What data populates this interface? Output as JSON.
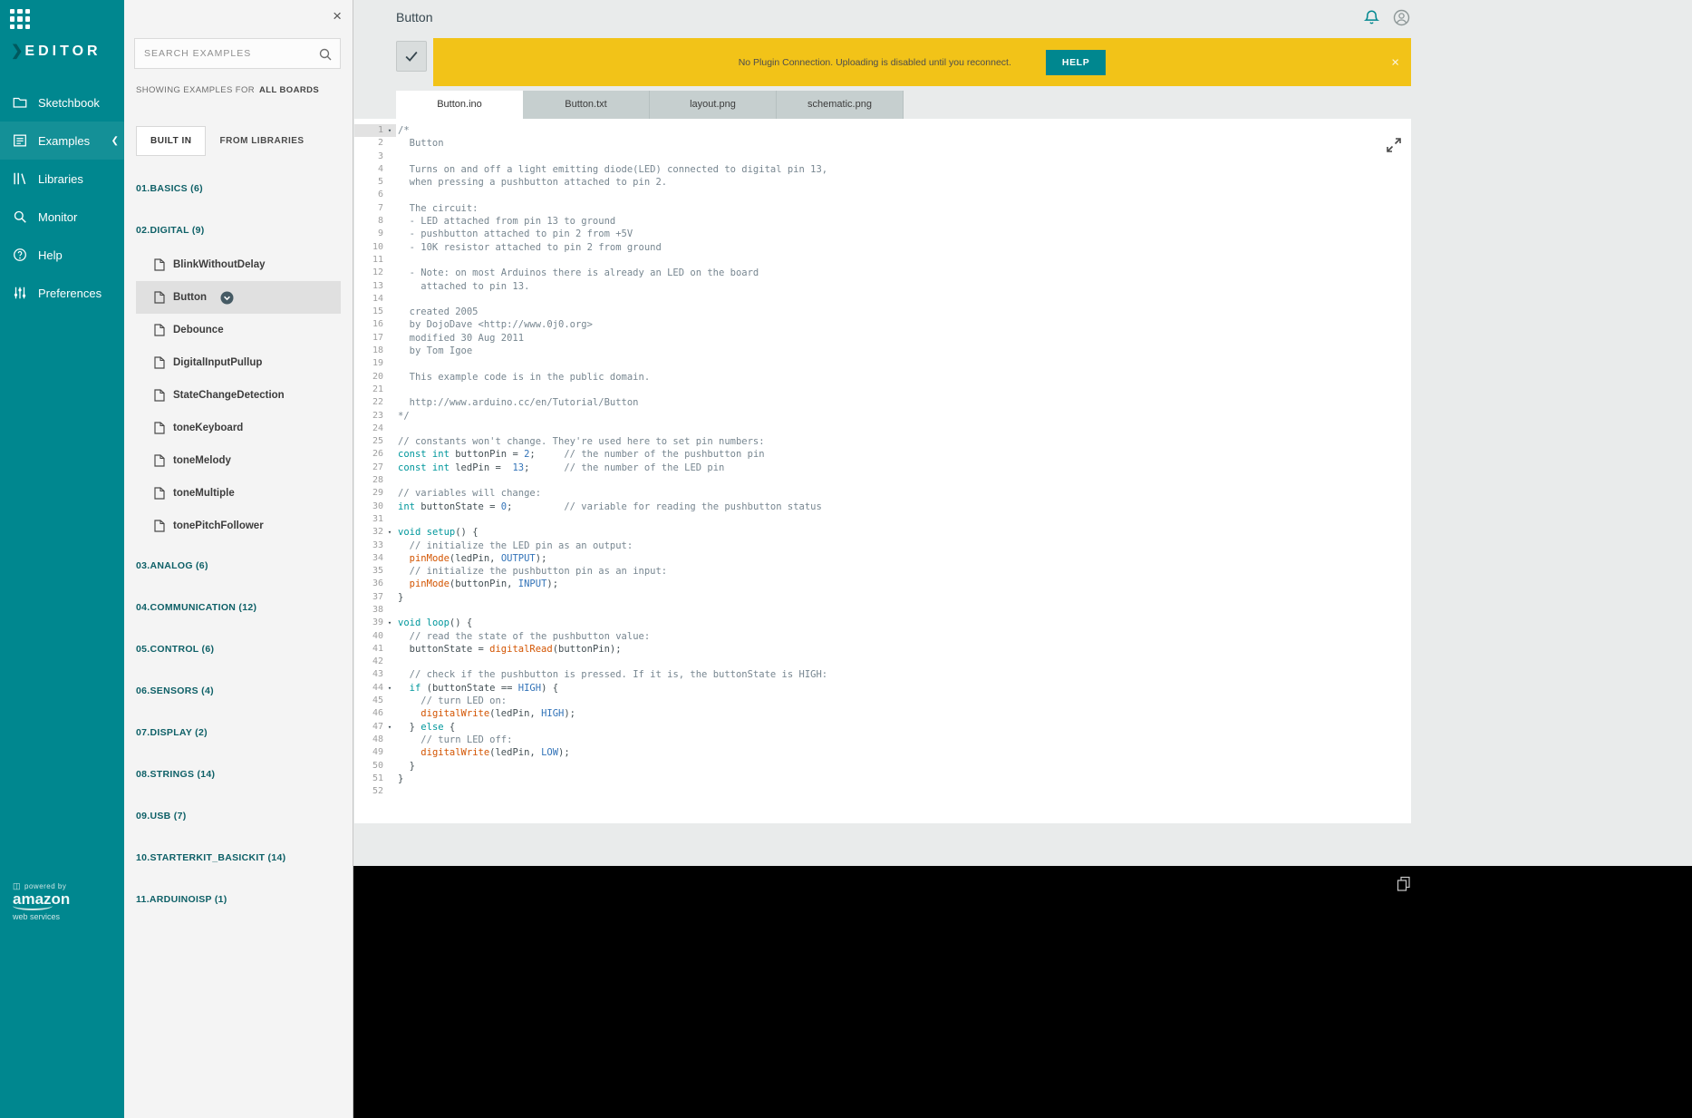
{
  "app": {
    "logo_text": "EDITOR"
  },
  "colors": {
    "teal": "#00878f",
    "banner_yellow": "#f2c318"
  },
  "sidebar": {
    "items": [
      {
        "label": "Sketchbook",
        "icon": "sketchbook",
        "active": false
      },
      {
        "label": "Examples",
        "icon": "examples",
        "active": true
      },
      {
        "label": "Libraries",
        "icon": "libraries",
        "active": false
      },
      {
        "label": "Monitor",
        "icon": "monitor",
        "active": false
      },
      {
        "label": "Help",
        "icon": "help",
        "active": false
      },
      {
        "label": "Preferences",
        "icon": "preferences",
        "active": false
      }
    ],
    "footer": {
      "powered_by": "powered by",
      "brand": "amazon",
      "brand_sub": "web services"
    }
  },
  "examples_panel": {
    "close_label": "×",
    "search_placeholder": "SEARCH EXAMPLES",
    "showing_prefix": "SHOWING EXAMPLES FOR",
    "showing_value": "ALL BOARDS",
    "tabs": [
      {
        "label": "BUILT IN",
        "active": true
      },
      {
        "label": "FROM LIBRARIES",
        "active": false
      }
    ],
    "categories": [
      {
        "label": "01.BASICS (6)"
      },
      {
        "label": "02.DIGITAL (9)",
        "items": [
          {
            "label": "BlinkWithoutDelay"
          },
          {
            "label": "Button",
            "selected": true,
            "badge": true
          },
          {
            "label": "Debounce"
          },
          {
            "label": "DigitalInputPullup"
          },
          {
            "label": "StateChangeDetection"
          },
          {
            "label": "toneKeyboard"
          },
          {
            "label": "toneMelody"
          },
          {
            "label": "toneMultiple"
          },
          {
            "label": "tonePitchFollower"
          }
        ]
      },
      {
        "label": "03.ANALOG (6)"
      },
      {
        "label": "04.COMMUNICATION (12)"
      },
      {
        "label": "05.CONTROL (6)"
      },
      {
        "label": "06.SENSORS (4)"
      },
      {
        "label": "07.DISPLAY (2)"
      },
      {
        "label": "08.STRINGS (14)"
      },
      {
        "label": "09.USB (7)"
      },
      {
        "label": "10.STARTERKIT_BASICKIT (14)"
      },
      {
        "label": "11.ARDUINOISP (1)"
      }
    ]
  },
  "header": {
    "title": "Button"
  },
  "banner": {
    "message": "No Plugin Connection. Uploading is disabled until you reconnect.",
    "help_label": "HELP",
    "close_label": "×"
  },
  "file_tabs": [
    {
      "label": "Button.ino",
      "active": true
    },
    {
      "label": "Button.txt",
      "active": false
    },
    {
      "label": "layout.png",
      "active": false
    },
    {
      "label": "schematic.png",
      "active": false
    }
  ],
  "editor": {
    "lines": [
      {
        "f": 1,
        "s": [
          [
            "c",
            "/*"
          ]
        ]
      },
      {
        "s": [
          [
            "c",
            "  Button"
          ]
        ]
      },
      {
        "s": []
      },
      {
        "s": [
          [
            "c",
            "  Turns on and off a light emitting diode(LED) connected to digital pin 13,"
          ]
        ]
      },
      {
        "s": [
          [
            "c",
            "  when pressing a pushbutton attached to pin 2."
          ]
        ]
      },
      {
        "s": []
      },
      {
        "s": [
          [
            "c",
            "  The circuit:"
          ]
        ]
      },
      {
        "s": [
          [
            "c",
            "  - LED attached from pin 13 to ground"
          ]
        ]
      },
      {
        "s": [
          [
            "c",
            "  - pushbutton attached to pin 2 from +5V"
          ]
        ]
      },
      {
        "s": [
          [
            "c",
            "  - 10K resistor attached to pin 2 from ground"
          ]
        ]
      },
      {
        "s": []
      },
      {
        "s": [
          [
            "c",
            "  - Note: on most Arduinos there is already an LED on the board"
          ]
        ]
      },
      {
        "s": [
          [
            "c",
            "    attached to pin 13."
          ]
        ]
      },
      {
        "s": []
      },
      {
        "s": [
          [
            "c",
            "  created 2005"
          ]
        ]
      },
      {
        "s": [
          [
            "c",
            "  by DojoDave <http://www.0j0.org>"
          ]
        ]
      },
      {
        "s": [
          [
            "c",
            "  modified 30 Aug 2011"
          ]
        ]
      },
      {
        "s": [
          [
            "c",
            "  by Tom Igoe"
          ]
        ]
      },
      {
        "s": []
      },
      {
        "s": [
          [
            "c",
            "  This example code is in the public domain."
          ]
        ]
      },
      {
        "s": []
      },
      {
        "s": [
          [
            "c",
            "  http://www.arduino.cc/en/Tutorial/Button"
          ]
        ]
      },
      {
        "s": [
          [
            "c",
            "*/"
          ]
        ]
      },
      {
        "s": []
      },
      {
        "s": [
          [
            "c",
            "// constants won't change. They're used here to set pin numbers:"
          ]
        ]
      },
      {
        "s": [
          [
            "k",
            "const int"
          ],
          [
            "t",
            " buttonPin = "
          ],
          [
            "n",
            "2"
          ],
          [
            "t",
            ";     "
          ],
          [
            "c",
            "// the number of the pushbutton pin"
          ]
        ]
      },
      {
        "s": [
          [
            "k",
            "const int"
          ],
          [
            "t",
            " ledPin =  "
          ],
          [
            "n",
            "13"
          ],
          [
            "t",
            ";      "
          ],
          [
            "c",
            "// the number of the LED pin"
          ]
        ]
      },
      {
        "s": []
      },
      {
        "s": [
          [
            "c",
            "// variables will change:"
          ]
        ]
      },
      {
        "s": [
          [
            "k",
            "int"
          ],
          [
            "t",
            " buttonState = "
          ],
          [
            "n",
            "0"
          ],
          [
            "t",
            ";         "
          ],
          [
            "c",
            "// variable for reading the pushbutton status"
          ]
        ]
      },
      {
        "s": []
      },
      {
        "f": 1,
        "s": [
          [
            "k",
            "void"
          ],
          [
            "t",
            " "
          ],
          [
            "k",
            "setup"
          ],
          [
            "t",
            "() {"
          ]
        ]
      },
      {
        "s": [
          [
            "t",
            "  "
          ],
          [
            "c",
            "// initialize the LED pin as an output:"
          ]
        ]
      },
      {
        "s": [
          [
            "t",
            "  "
          ],
          [
            "f",
            "pinMode"
          ],
          [
            "t",
            "(ledPin, "
          ],
          [
            "n",
            "OUTPUT"
          ],
          [
            "t",
            ");"
          ]
        ]
      },
      {
        "s": [
          [
            "t",
            "  "
          ],
          [
            "c",
            "// initialize the pushbutton pin as an input:"
          ]
        ]
      },
      {
        "s": [
          [
            "t",
            "  "
          ],
          [
            "f",
            "pinMode"
          ],
          [
            "t",
            "(buttonPin, "
          ],
          [
            "n",
            "INPUT"
          ],
          [
            "t",
            ");"
          ]
        ]
      },
      {
        "s": [
          [
            "t",
            "}"
          ]
        ]
      },
      {
        "s": []
      },
      {
        "f": 1,
        "s": [
          [
            "k",
            "void"
          ],
          [
            "t",
            " "
          ],
          [
            "k",
            "loop"
          ],
          [
            "t",
            "() {"
          ]
        ]
      },
      {
        "s": [
          [
            "t",
            "  "
          ],
          [
            "c",
            "// read the state of the pushbutton value:"
          ]
        ]
      },
      {
        "s": [
          [
            "t",
            "  buttonState = "
          ],
          [
            "f",
            "digitalRead"
          ],
          [
            "t",
            "(buttonPin);"
          ]
        ]
      },
      {
        "s": []
      },
      {
        "s": [
          [
            "t",
            "  "
          ],
          [
            "c",
            "// check if the pushbutton is pressed. If it is, the buttonState is HIGH:"
          ]
        ]
      },
      {
        "f": 1,
        "s": [
          [
            "t",
            "  "
          ],
          [
            "k",
            "if"
          ],
          [
            "t",
            " (buttonState == "
          ],
          [
            "n",
            "HIGH"
          ],
          [
            "t",
            ") {"
          ]
        ]
      },
      {
        "s": [
          [
            "t",
            "    "
          ],
          [
            "c",
            "// turn LED on:"
          ]
        ]
      },
      {
        "s": [
          [
            "t",
            "    "
          ],
          [
            "f",
            "digitalWrite"
          ],
          [
            "t",
            "(ledPin, "
          ],
          [
            "n",
            "HIGH"
          ],
          [
            "t",
            ");"
          ]
        ]
      },
      {
        "f": 1,
        "s": [
          [
            "t",
            "  } "
          ],
          [
            "k",
            "else"
          ],
          [
            "t",
            " {"
          ]
        ]
      },
      {
        "s": [
          [
            "t",
            "    "
          ],
          [
            "c",
            "// turn LED off:"
          ]
        ]
      },
      {
        "s": [
          [
            "t",
            "    "
          ],
          [
            "f",
            "digitalWrite"
          ],
          [
            "t",
            "(ledPin, "
          ],
          [
            "n",
            "LOW"
          ],
          [
            "t",
            ");"
          ]
        ]
      },
      {
        "s": [
          [
            "t",
            "  }"
          ]
        ]
      },
      {
        "s": [
          [
            "t",
            "}"
          ]
        ]
      },
      {
        "s": []
      }
    ]
  }
}
